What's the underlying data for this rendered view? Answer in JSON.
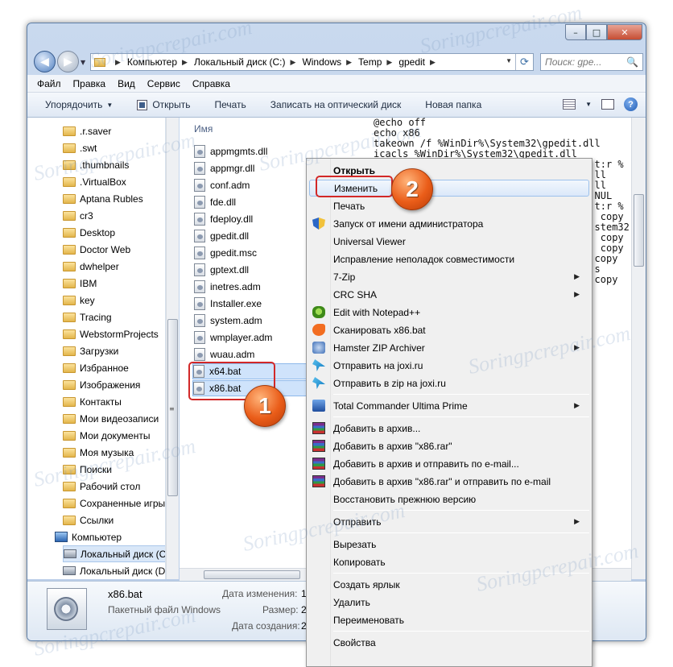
{
  "window": {
    "caption_buttons": {
      "min": "–",
      "max": "□",
      "close": "✕"
    }
  },
  "address": {
    "crumbs": [
      "Компьютер",
      "Локальный диск (C:)",
      "Windows",
      "Temp",
      "gpedit"
    ],
    "search_placeholder": "Поиск: gpe..."
  },
  "menubar": [
    "Файл",
    "Правка",
    "Вид",
    "Сервис",
    "Справка"
  ],
  "toolbar": {
    "organize": "Упорядочить",
    "open": "Открыть",
    "print": "Печать",
    "burn": "Записать на оптический диск",
    "new_folder": "Новая папка",
    "help": "?"
  },
  "nav_items": [
    {
      "label": ".r.saver",
      "icon": "folder-icon"
    },
    {
      "label": ".swt",
      "icon": "folder-icon"
    },
    {
      "label": ".thumbnails",
      "icon": "folder-icon"
    },
    {
      "label": ".VirtualBox",
      "icon": "folder-icon"
    },
    {
      "label": "Aptana Rubles",
      "icon": "folder-icon"
    },
    {
      "label": "cr3",
      "icon": "folder-icon"
    },
    {
      "label": "Desktop",
      "icon": "folder-icon"
    },
    {
      "label": "Doctor Web",
      "icon": "folder-icon"
    },
    {
      "label": "dwhelper",
      "icon": "folder-icon"
    },
    {
      "label": "IBM",
      "icon": "folder-icon"
    },
    {
      "label": "key",
      "icon": "folder-icon"
    },
    {
      "label": "Tracing",
      "icon": "folder-icon"
    },
    {
      "label": "WebstormProjects",
      "icon": "folder-icon"
    },
    {
      "label": "Загрузки",
      "icon": "folder-icon"
    },
    {
      "label": "Избранное",
      "icon": "folder-icon"
    },
    {
      "label": "Изображения",
      "icon": "folder-icon"
    },
    {
      "label": "Контакты",
      "icon": "folder-icon"
    },
    {
      "label": "Мои видеозаписи",
      "icon": "folder-icon"
    },
    {
      "label": "Мои документы",
      "icon": "folder-icon"
    },
    {
      "label": "Моя музыка",
      "icon": "folder-icon"
    },
    {
      "label": "Поиски",
      "icon": "folder-icon"
    },
    {
      "label": "Рабочий стол",
      "icon": "folder-icon"
    },
    {
      "label": "Сохраненные игры",
      "icon": "folder-icon"
    },
    {
      "label": "Ссылки",
      "icon": "folder-icon"
    },
    {
      "label": "Компьютер",
      "icon": "computer-icon"
    },
    {
      "label": "Локальный диск (C",
      "icon": "drive-icon",
      "selected": true
    },
    {
      "label": "Локальный диск (D",
      "icon": "drive-icon"
    }
  ],
  "files": {
    "column": "Имя",
    "items": [
      "appmgmts.dll",
      "appmgr.dll",
      "conf.adm",
      "fde.dll",
      "fdeploy.dll",
      "gpedit.dll",
      "gpedit.msc",
      "gptext.dll",
      "inetres.adm",
      "Installer.exe",
      "system.adm",
      "wmplayer.adm",
      "wuau.adm",
      "x64.bat",
      "x86.bat"
    ]
  },
  "notepad_lines": [
    "@echo off",
    "echo x86",
    "takeown /f %WinDir%\\System32\\gpedit.dll",
    "icacls %WinDir%\\System32\\gpedit.dll",
    "                                      t:r %",
    "                                      ll",
    "",
    "",
    "",
    "",
    "",
    "",
    "",
    "",
    "",
    "",
    "                                      ll",
    "",
    "",
    "",
    "                                      NUL",
    "",
    "",
    "                                      t:r %",
    "",
    "",
    "                                       copy",
    "",
    "                                      stem32",
    "",
    "                                       copy",
    "",
    "",
    "                                       copy",
    "",
    "                                      copy",
    "                                      s",
    "",
    "                                      copy"
  ],
  "details": {
    "name": "x86.bat",
    "type": "Пакетный файл Windows",
    "modified_label": "Дата изменения:",
    "size_label": "Размер:",
    "created_label": "Дата создания:",
    "modified_value": "1",
    "size_value": "2",
    "created_value": "2"
  },
  "context_menu": [
    {
      "label": "Открыть",
      "bold": true
    },
    {
      "label": "Изменить",
      "hover": true
    },
    {
      "label": "Печать"
    },
    {
      "label": "Запуск от имени администратора",
      "icon": "shield-icon"
    },
    {
      "label": "Universal Viewer"
    },
    {
      "label": "Исправление неполадок совместимости"
    },
    {
      "label": "7-Zip",
      "submenu": true
    },
    {
      "label": "CRC SHA",
      "submenu": true
    },
    {
      "label": "Edit with Notepad++",
      "icon": "notepadpp-icon"
    },
    {
      "label": "Сканировать x86.bat",
      "icon": "avast-icon"
    },
    {
      "label": "Hamster ZIP Archiver",
      "icon": "hamster-icon",
      "submenu": true
    },
    {
      "label": "Отправить на joxi.ru",
      "icon": "joxi-icon"
    },
    {
      "label": "Отправить в zip на joxi.ru",
      "icon": "joxi-icon"
    },
    {
      "separator": true
    },
    {
      "label": "Total Commander Ultima Prime",
      "icon": "total-commander-icon",
      "submenu": true
    },
    {
      "separator": true
    },
    {
      "label": "Добавить в архив...",
      "icon": "winrar-icon"
    },
    {
      "label": "Добавить в архив \"x86.rar\"",
      "icon": "winrar-icon"
    },
    {
      "label": "Добавить в архив и отправить по e-mail...",
      "icon": "winrar-icon"
    },
    {
      "label": "Добавить в архив \"x86.rar\" и отправить по e-mail",
      "icon": "winrar-icon"
    },
    {
      "label": "Восстановить прежнюю версию"
    },
    {
      "separator": true
    },
    {
      "label": "Отправить",
      "submenu": true
    },
    {
      "separator": true
    },
    {
      "label": "Вырезать"
    },
    {
      "label": "Копировать"
    },
    {
      "separator": true
    },
    {
      "label": "Создать ярлык"
    },
    {
      "label": "Удалить"
    },
    {
      "label": "Переименовать"
    },
    {
      "separator": true
    },
    {
      "label": "Свойства"
    }
  ],
  "markers": {
    "one": "1",
    "two": "2"
  },
  "watermark": "Soringpcrepair.com"
}
